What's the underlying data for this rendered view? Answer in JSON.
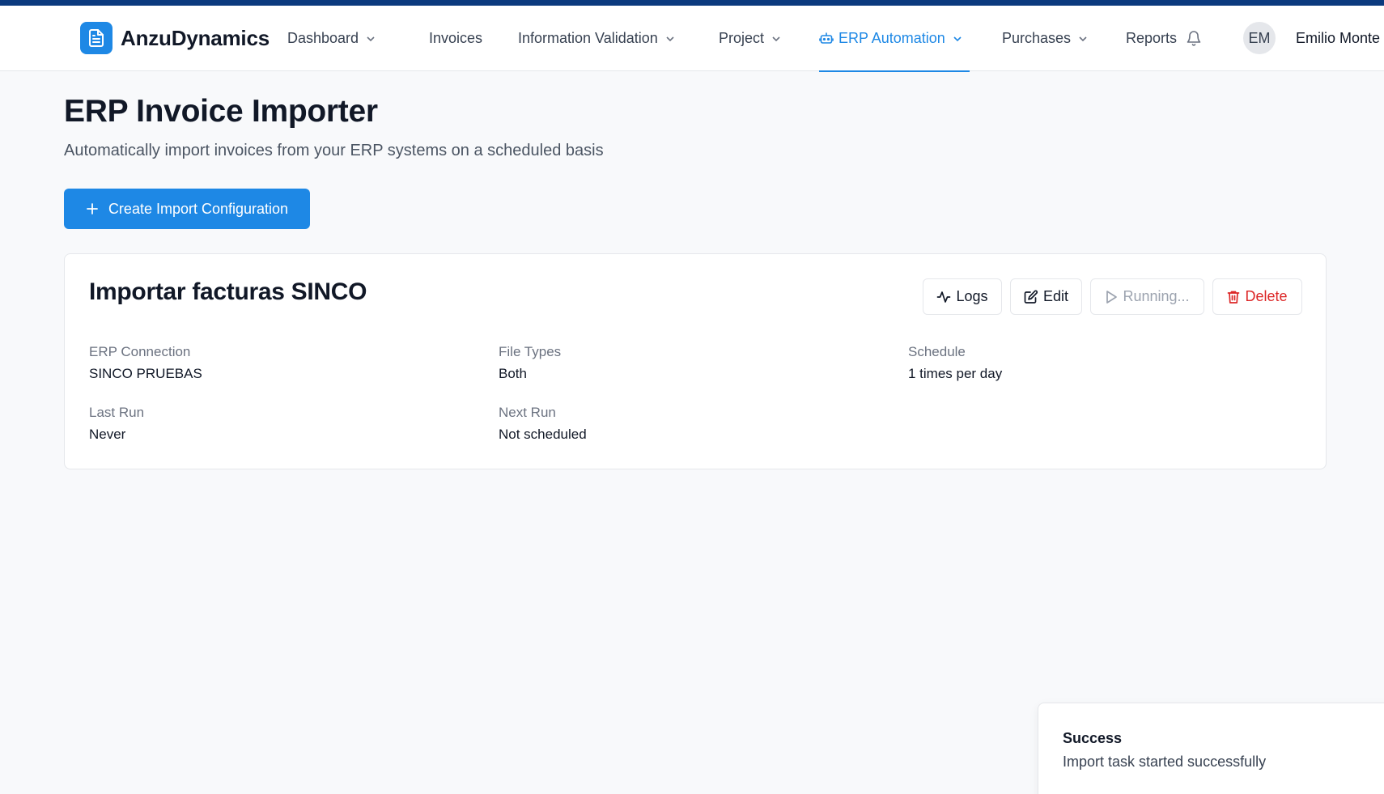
{
  "app": {
    "brand": "AnzuDynamics",
    "accent_color": "#1e88e5",
    "top_strip_color": "#0b3a7e"
  },
  "nav": {
    "items": [
      {
        "label": "Dashboard",
        "has_dropdown": true
      },
      {
        "label": "Invoices",
        "has_dropdown": false
      },
      {
        "label": "Information Validation",
        "has_dropdown": true
      },
      {
        "label": "Project",
        "has_dropdown": true
      },
      {
        "label": "ERP Automation",
        "has_dropdown": true,
        "active": true,
        "icon": "robot-icon"
      },
      {
        "label": "Purchases",
        "has_dropdown": true
      },
      {
        "label": "Reports",
        "has_dropdown": false
      }
    ],
    "notification_icon": "bell-icon",
    "user_initials": "EM",
    "user_name": "Emilio Monte"
  },
  "page": {
    "title": "ERP Invoice Importer",
    "subtitle": "Automatically import invoices from your ERP systems on a scheduled basis",
    "create_button_label": "Create Import Configuration"
  },
  "config_card": {
    "title": "Importar facturas SINCO",
    "actions": {
      "logs_label": "Logs",
      "edit_label": "Edit",
      "run_label": "Running...",
      "delete_label": "Delete"
    },
    "fields": {
      "erp_connection_label": "ERP Connection",
      "erp_connection_value": "SINCO PRUEBAS",
      "file_types_label": "File Types",
      "file_types_value": "Both",
      "schedule_label": "Schedule",
      "schedule_value": "1 times per day",
      "last_run_label": "Last Run",
      "last_run_value": "Never",
      "next_run_label": "Next Run",
      "next_run_value": "Not scheduled"
    }
  },
  "toast": {
    "title": "Success",
    "message": "Import task started successfully"
  }
}
